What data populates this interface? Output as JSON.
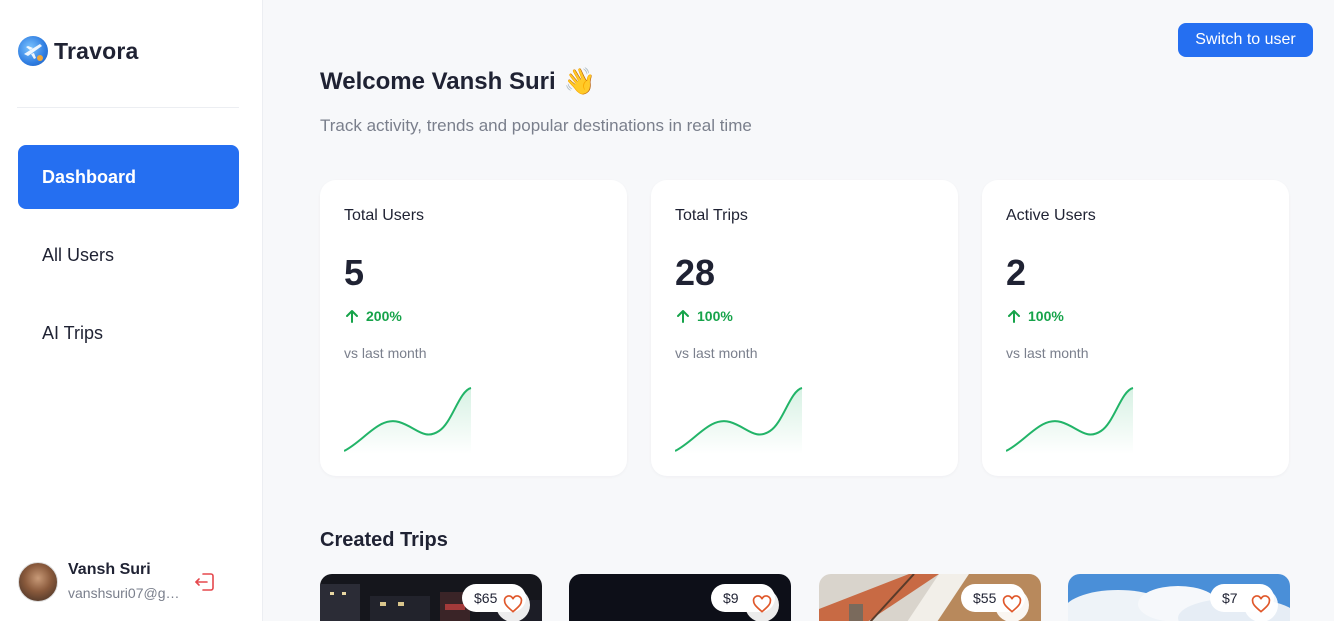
{
  "brand": {
    "name": "Travora",
    "logo_icon": "globe-airplane-icon"
  },
  "sidebar": {
    "items": [
      {
        "label": "Dashboard",
        "active": true
      },
      {
        "label": "All Users",
        "active": false
      },
      {
        "label": "AI Trips",
        "active": false
      }
    ],
    "user": {
      "name": "Vansh Suri",
      "email": "vanshsuri07@g…"
    },
    "logout_icon": "logout-icon"
  },
  "header": {
    "switch_label": "Switch to user",
    "welcome": "Welcome Vansh Suri",
    "wave": "👋",
    "subtitle": "Track activity, trends and popular destinations in real time"
  },
  "stats": [
    {
      "label": "Total Users",
      "value": "5",
      "change": "200%",
      "vs": "vs last month"
    },
    {
      "label": "Total Trips",
      "value": "28",
      "change": "100%",
      "vs": "vs last month"
    },
    {
      "label": "Active Users",
      "value": "2",
      "change": "100%",
      "vs": "vs last month"
    }
  ],
  "colors": {
    "accent": "#256ff1",
    "positive": "#16a34a",
    "sparkline": "#22b468"
  },
  "trips": {
    "title": "Created Trips",
    "cards": [
      {
        "price": "$65",
        "image": "night-city-street"
      },
      {
        "price": "$9",
        "image": "dark-night-scene"
      },
      {
        "price": "$55",
        "image": "tiled-roof-house"
      },
      {
        "price": "$7",
        "image": "blue-sky-clouds"
      }
    ]
  }
}
